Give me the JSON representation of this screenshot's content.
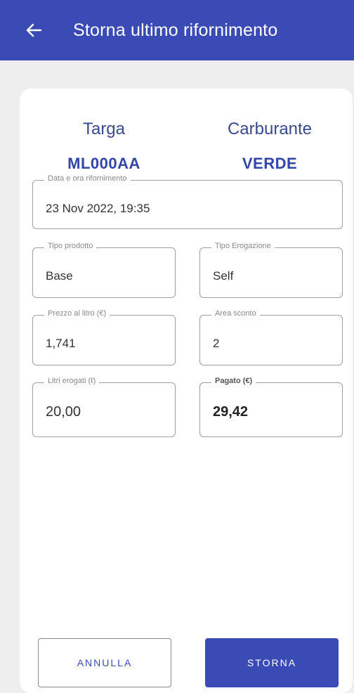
{
  "header": {
    "title": "Storna ultimo rifornimento",
    "back_icon": "arrow-left-icon",
    "color": "#3b4bb5"
  },
  "vehicle": {
    "plate_label": "Targa",
    "plate_value": "ML000AA",
    "fuel_label": "Carburante",
    "fuel_value": "VERDE"
  },
  "form": {
    "datetime": {
      "label": "Data e ora rifornimento",
      "value": "23 Nov 2022, 19:35"
    },
    "product_type": {
      "label": "Tipo prodotto",
      "value": "Base"
    },
    "delivery_type": {
      "label": "Tipo Erogazione",
      "value": "Self"
    },
    "price_per_liter": {
      "label": "Prezzo al litro (€)",
      "value": "1,741"
    },
    "discount_area": {
      "label": "Area sconto",
      "value": "2"
    },
    "liters": {
      "label": "Litri erogati (ℓ)",
      "value": "20,00"
    },
    "paid": {
      "label": "Pagato (€)",
      "value": "29,42"
    }
  },
  "actions": {
    "cancel_label": "ANNULLA",
    "confirm_label": "STORNA"
  }
}
